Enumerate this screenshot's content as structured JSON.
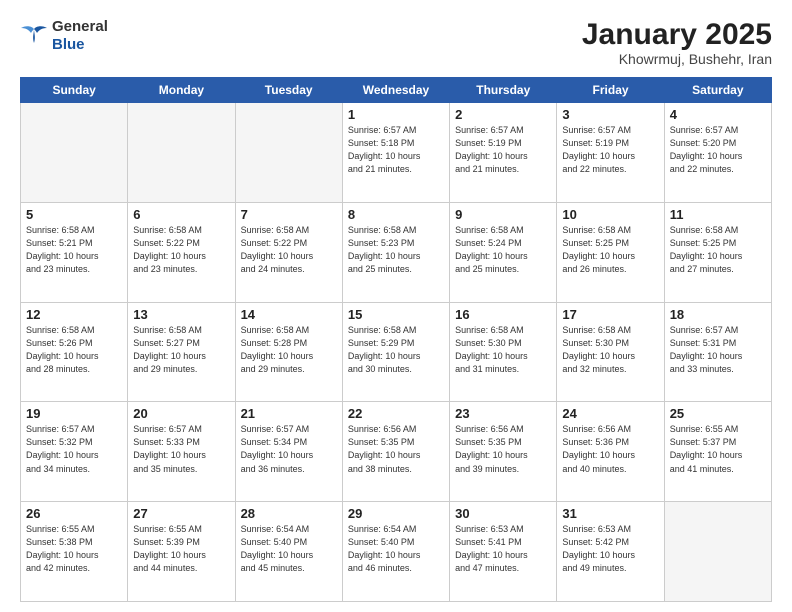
{
  "header": {
    "logo_line1": "General",
    "logo_line2": "Blue",
    "title": "January 2025",
    "subtitle": "Khowrmuj, Bushehr, Iran"
  },
  "days_of_week": [
    "Sunday",
    "Monday",
    "Tuesday",
    "Wednesday",
    "Thursday",
    "Friday",
    "Saturday"
  ],
  "weeks": [
    [
      {
        "day": "",
        "info": ""
      },
      {
        "day": "",
        "info": ""
      },
      {
        "day": "",
        "info": ""
      },
      {
        "day": "1",
        "info": "Sunrise: 6:57 AM\nSunset: 5:18 PM\nDaylight: 10 hours\nand 21 minutes."
      },
      {
        "day": "2",
        "info": "Sunrise: 6:57 AM\nSunset: 5:19 PM\nDaylight: 10 hours\nand 21 minutes."
      },
      {
        "day": "3",
        "info": "Sunrise: 6:57 AM\nSunset: 5:19 PM\nDaylight: 10 hours\nand 22 minutes."
      },
      {
        "day": "4",
        "info": "Sunrise: 6:57 AM\nSunset: 5:20 PM\nDaylight: 10 hours\nand 22 minutes."
      }
    ],
    [
      {
        "day": "5",
        "info": "Sunrise: 6:58 AM\nSunset: 5:21 PM\nDaylight: 10 hours\nand 23 minutes."
      },
      {
        "day": "6",
        "info": "Sunrise: 6:58 AM\nSunset: 5:22 PM\nDaylight: 10 hours\nand 23 minutes."
      },
      {
        "day": "7",
        "info": "Sunrise: 6:58 AM\nSunset: 5:22 PM\nDaylight: 10 hours\nand 24 minutes."
      },
      {
        "day": "8",
        "info": "Sunrise: 6:58 AM\nSunset: 5:23 PM\nDaylight: 10 hours\nand 25 minutes."
      },
      {
        "day": "9",
        "info": "Sunrise: 6:58 AM\nSunset: 5:24 PM\nDaylight: 10 hours\nand 25 minutes."
      },
      {
        "day": "10",
        "info": "Sunrise: 6:58 AM\nSunset: 5:25 PM\nDaylight: 10 hours\nand 26 minutes."
      },
      {
        "day": "11",
        "info": "Sunrise: 6:58 AM\nSunset: 5:25 PM\nDaylight: 10 hours\nand 27 minutes."
      }
    ],
    [
      {
        "day": "12",
        "info": "Sunrise: 6:58 AM\nSunset: 5:26 PM\nDaylight: 10 hours\nand 28 minutes."
      },
      {
        "day": "13",
        "info": "Sunrise: 6:58 AM\nSunset: 5:27 PM\nDaylight: 10 hours\nand 29 minutes."
      },
      {
        "day": "14",
        "info": "Sunrise: 6:58 AM\nSunset: 5:28 PM\nDaylight: 10 hours\nand 29 minutes."
      },
      {
        "day": "15",
        "info": "Sunrise: 6:58 AM\nSunset: 5:29 PM\nDaylight: 10 hours\nand 30 minutes."
      },
      {
        "day": "16",
        "info": "Sunrise: 6:58 AM\nSunset: 5:30 PM\nDaylight: 10 hours\nand 31 minutes."
      },
      {
        "day": "17",
        "info": "Sunrise: 6:58 AM\nSunset: 5:30 PM\nDaylight: 10 hours\nand 32 minutes."
      },
      {
        "day": "18",
        "info": "Sunrise: 6:57 AM\nSunset: 5:31 PM\nDaylight: 10 hours\nand 33 minutes."
      }
    ],
    [
      {
        "day": "19",
        "info": "Sunrise: 6:57 AM\nSunset: 5:32 PM\nDaylight: 10 hours\nand 34 minutes."
      },
      {
        "day": "20",
        "info": "Sunrise: 6:57 AM\nSunset: 5:33 PM\nDaylight: 10 hours\nand 35 minutes."
      },
      {
        "day": "21",
        "info": "Sunrise: 6:57 AM\nSunset: 5:34 PM\nDaylight: 10 hours\nand 36 minutes."
      },
      {
        "day": "22",
        "info": "Sunrise: 6:56 AM\nSunset: 5:35 PM\nDaylight: 10 hours\nand 38 minutes."
      },
      {
        "day": "23",
        "info": "Sunrise: 6:56 AM\nSunset: 5:35 PM\nDaylight: 10 hours\nand 39 minutes."
      },
      {
        "day": "24",
        "info": "Sunrise: 6:56 AM\nSunset: 5:36 PM\nDaylight: 10 hours\nand 40 minutes."
      },
      {
        "day": "25",
        "info": "Sunrise: 6:55 AM\nSunset: 5:37 PM\nDaylight: 10 hours\nand 41 minutes."
      }
    ],
    [
      {
        "day": "26",
        "info": "Sunrise: 6:55 AM\nSunset: 5:38 PM\nDaylight: 10 hours\nand 42 minutes."
      },
      {
        "day": "27",
        "info": "Sunrise: 6:55 AM\nSunset: 5:39 PM\nDaylight: 10 hours\nand 44 minutes."
      },
      {
        "day": "28",
        "info": "Sunrise: 6:54 AM\nSunset: 5:40 PM\nDaylight: 10 hours\nand 45 minutes."
      },
      {
        "day": "29",
        "info": "Sunrise: 6:54 AM\nSunset: 5:40 PM\nDaylight: 10 hours\nand 46 minutes."
      },
      {
        "day": "30",
        "info": "Sunrise: 6:53 AM\nSunset: 5:41 PM\nDaylight: 10 hours\nand 47 minutes."
      },
      {
        "day": "31",
        "info": "Sunrise: 6:53 AM\nSunset: 5:42 PM\nDaylight: 10 hours\nand 49 minutes."
      },
      {
        "day": "",
        "info": ""
      }
    ]
  ]
}
